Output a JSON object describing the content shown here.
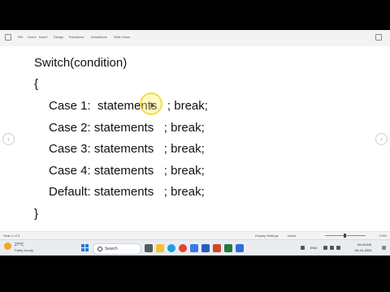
{
  "ribbon": {
    "items": [
      "File",
      "Home",
      "Insert",
      "Design",
      "Transitions",
      "Animations",
      "Slide Show"
    ]
  },
  "slide": {
    "lines": [
      "Switch(condition)",
      "{",
      "Case 1:  statements   ; break;",
      "Case 2: statements   ; break;",
      "Case 3: statements   ; break;",
      "Case 4: statements   ; break;",
      "Default: statements   ; break;",
      "}"
    ]
  },
  "status": {
    "slide_info": "Slide 3 of 3",
    "display_settings": "Display Settings",
    "notes": "Notes",
    "zoom": "178%"
  },
  "taskbar": {
    "weather_temp": "27°C",
    "weather_desc": "Partly cloudy",
    "search_label": "Search",
    "language": "ENG",
    "time": "05:43 AM",
    "date": "04-12-2024",
    "apps": [
      {
        "name": "task-view",
        "color": "#5a5a5a"
      },
      {
        "name": "file-explorer",
        "color": "#f2c233"
      },
      {
        "name": "edge",
        "color": "#1fa0d8"
      },
      {
        "name": "chrome",
        "color": "#e44134"
      },
      {
        "name": "store",
        "color": "#3b78e7"
      },
      {
        "name": "word",
        "color": "#2b5bb8"
      },
      {
        "name": "powerpoint",
        "color": "#d24726"
      },
      {
        "name": "excel",
        "color": "#1f7a44"
      },
      {
        "name": "app-blue",
        "color": "#2f6fd6"
      }
    ]
  },
  "colors": {
    "accent": "#1e7bd6",
    "cursor_highlight": "#ffec50"
  }
}
